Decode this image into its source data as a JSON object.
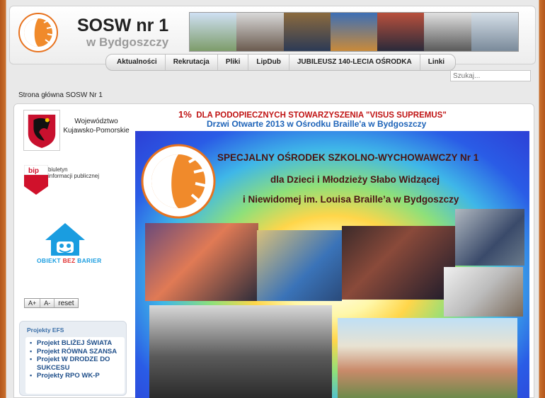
{
  "header": {
    "title": "SOSW nr 1",
    "subtitle": "w Bydgoszczy"
  },
  "nav": {
    "items": [
      "Aktualności",
      "Rekrutacja",
      "Pliki",
      "LipDub",
      "JUBILEUSZ 140-LECIA OŚRODKA",
      "Linki"
    ]
  },
  "search": {
    "placeholder": "Szukaj..."
  },
  "breadcrumb": "Strona główna SOSW Nr 1",
  "sidebar": {
    "region_label_1": "Województwo",
    "region_label_2": "Kujawsko-Pomorskie",
    "bip_line1": "biuletyn",
    "bip_line2": "informacji publicznej",
    "bez_part1": "OBIEKT ",
    "bez_part2": "BEZ",
    "bez_part3": " BARIER",
    "fontsize": {
      "increase": "A+",
      "decrease": "A-",
      "reset": "reset"
    },
    "efs": {
      "title": "Projekty EFS",
      "items": [
        "Projekt BLIŻEJ ŚWIATA",
        "Projekt RÓWNA SZANSA",
        "Projekt W DRODZE DO SUKCESU",
        "Projekty RPO WK-P"
      ]
    }
  },
  "content": {
    "promo_pct": "1%",
    "promo_text": "DLA PODOPIECZNYCH STOWARZYSZENIA \"VISUS SUPREMUS\"",
    "promo_link": "Drzwi Otwarte 2013 w Ośrodku Braille'a w Bydgoszczy",
    "poster": {
      "line1": "SPECJALNY OŚRODEK SZKOLNO-WYCHOWAWCZY Nr 1",
      "line2": "dla Dzieci i Młodzieży Słabo Widzącej",
      "line3": "i Niewidomej im. Louisa Braille’a w Bydgoszczy"
    }
  },
  "colors": {
    "accent_orange": "#e8731f",
    "promo_red": "#c01414",
    "link_blue": "#1d63b8"
  }
}
